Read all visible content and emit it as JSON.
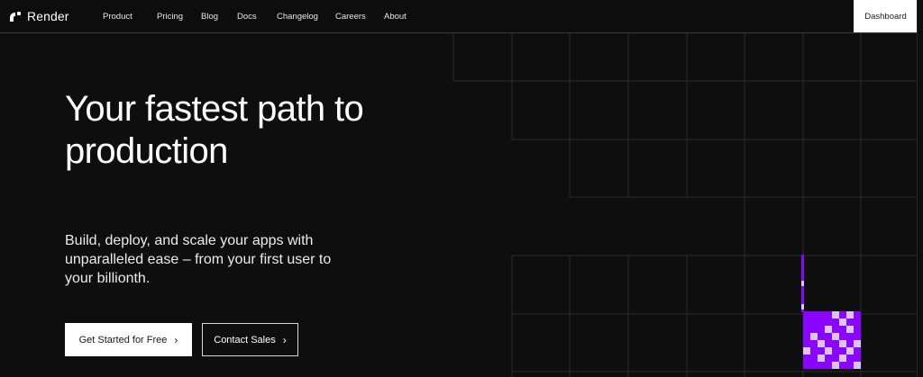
{
  "brand": {
    "name": "Render",
    "icon": "render-logo-icon"
  },
  "nav": {
    "items": [
      {
        "label": "Product"
      },
      {
        "label": "Pricing"
      },
      {
        "label": "Blog"
      },
      {
        "label": "Docs"
      },
      {
        "label": "Changelog"
      },
      {
        "label": "Careers"
      },
      {
        "label": "About"
      }
    ],
    "dashboard_label": "Dashboard"
  },
  "hero": {
    "title": "Your fastest path to production",
    "subtitle": "Build, deploy, and scale your apps with unparalleled ease – from your first user to your billionth.",
    "primary_cta": "Get Started for Free",
    "secondary_cta": "Contact Sales",
    "cta_icon": "chevron-right-icon"
  },
  "colors": {
    "background": "#0f0e0f",
    "accent": "#8a05ff",
    "grid_line": "#2b2b2b",
    "pixel_light": "#d9c6f5"
  }
}
